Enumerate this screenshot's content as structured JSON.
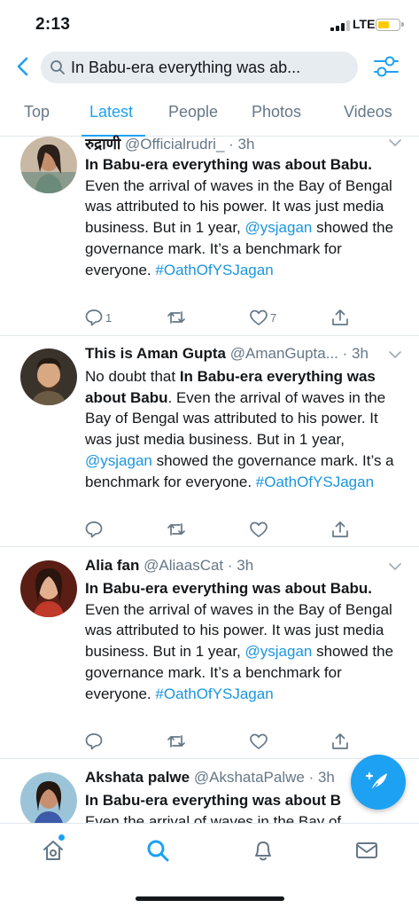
{
  "status_bar": {
    "time": "2:13",
    "network": "LTE",
    "battery_color": "#ffcc00"
  },
  "header": {
    "back_icon": "chevron-left-icon",
    "search_query": "In Babu-era everything was ab...",
    "filter_icon": "sliders-icon"
  },
  "tabs": [
    {
      "label": "Top",
      "active": false
    },
    {
      "label": "Latest",
      "active": true
    },
    {
      "label": "People",
      "active": false
    },
    {
      "label": "Photos",
      "active": false
    },
    {
      "label": "Videos",
      "active": false
    }
  ],
  "tweets": [
    {
      "name": "रुद्राणी",
      "handle": "@Officialrudri_",
      "sep": " · ",
      "time": "3h",
      "prefix": "",
      "bold": "In Babu-era everything was about Babu.",
      "text": " Even the arrival of waves in the Bay of Bengal was attributed to his power. It was just media business. But in 1 year, ",
      "mention": "@ysjagan",
      "text2": " showed the governance mark. It’s a benchmark for everyone. ",
      "hashtag": "#OathOfYSJagan",
      "replies": "1",
      "retweets": "",
      "likes": "7"
    },
    {
      "name": "This is Aman Gupta",
      "handle": "@AmanGupta...",
      "sep": " · ",
      "time": "3h",
      "prefix": "No doubt that ",
      "bold": "In Babu-era everything was about Babu",
      "text": ". Even the arrival of waves in the Bay of Bengal was attributed to his power. It was just media business. But in 1 year, ",
      "mention": "@ysjagan",
      "text2": " showed the governance mark. It’s a benchmark for everyone. ",
      "hashtag": "#OathOfYSJagan",
      "replies": "",
      "retweets": "",
      "likes": ""
    },
    {
      "name": "Alia fan",
      "handle": "@AliaasCat",
      "sep": " · ",
      "time": "3h",
      "prefix": "",
      "bold": "In Babu-era everything was about Babu.",
      "text": " Even the arrival of waves in the Bay of Bengal was attributed to his power. It was just media business. But in 1 year, ",
      "mention": "@ysjagan",
      "text2": " showed the governance mark. It’s a benchmark for everyone. ",
      "hashtag": "#OathOfYSJagan",
      "replies": "",
      "retweets": "",
      "likes": ""
    },
    {
      "name": "Akshata palwe",
      "handle": "@AkshataPalwe",
      "sep": " · ",
      "time": "3h",
      "prefix": "",
      "bold": "In Babu-era everything was about B",
      "text": " Even the arrival of waves in the Bay of",
      "mention": "",
      "text2": "",
      "hashtag": "",
      "replies": "",
      "retweets": "",
      "likes": ""
    }
  ],
  "colors": {
    "accent": "#1da1f2",
    "link": "#1b95e0",
    "muted": "#657786"
  },
  "bottom_nav": [
    "home-icon",
    "search-icon",
    "bell-icon",
    "mail-icon"
  ],
  "fab_icon": "compose-feather-icon"
}
